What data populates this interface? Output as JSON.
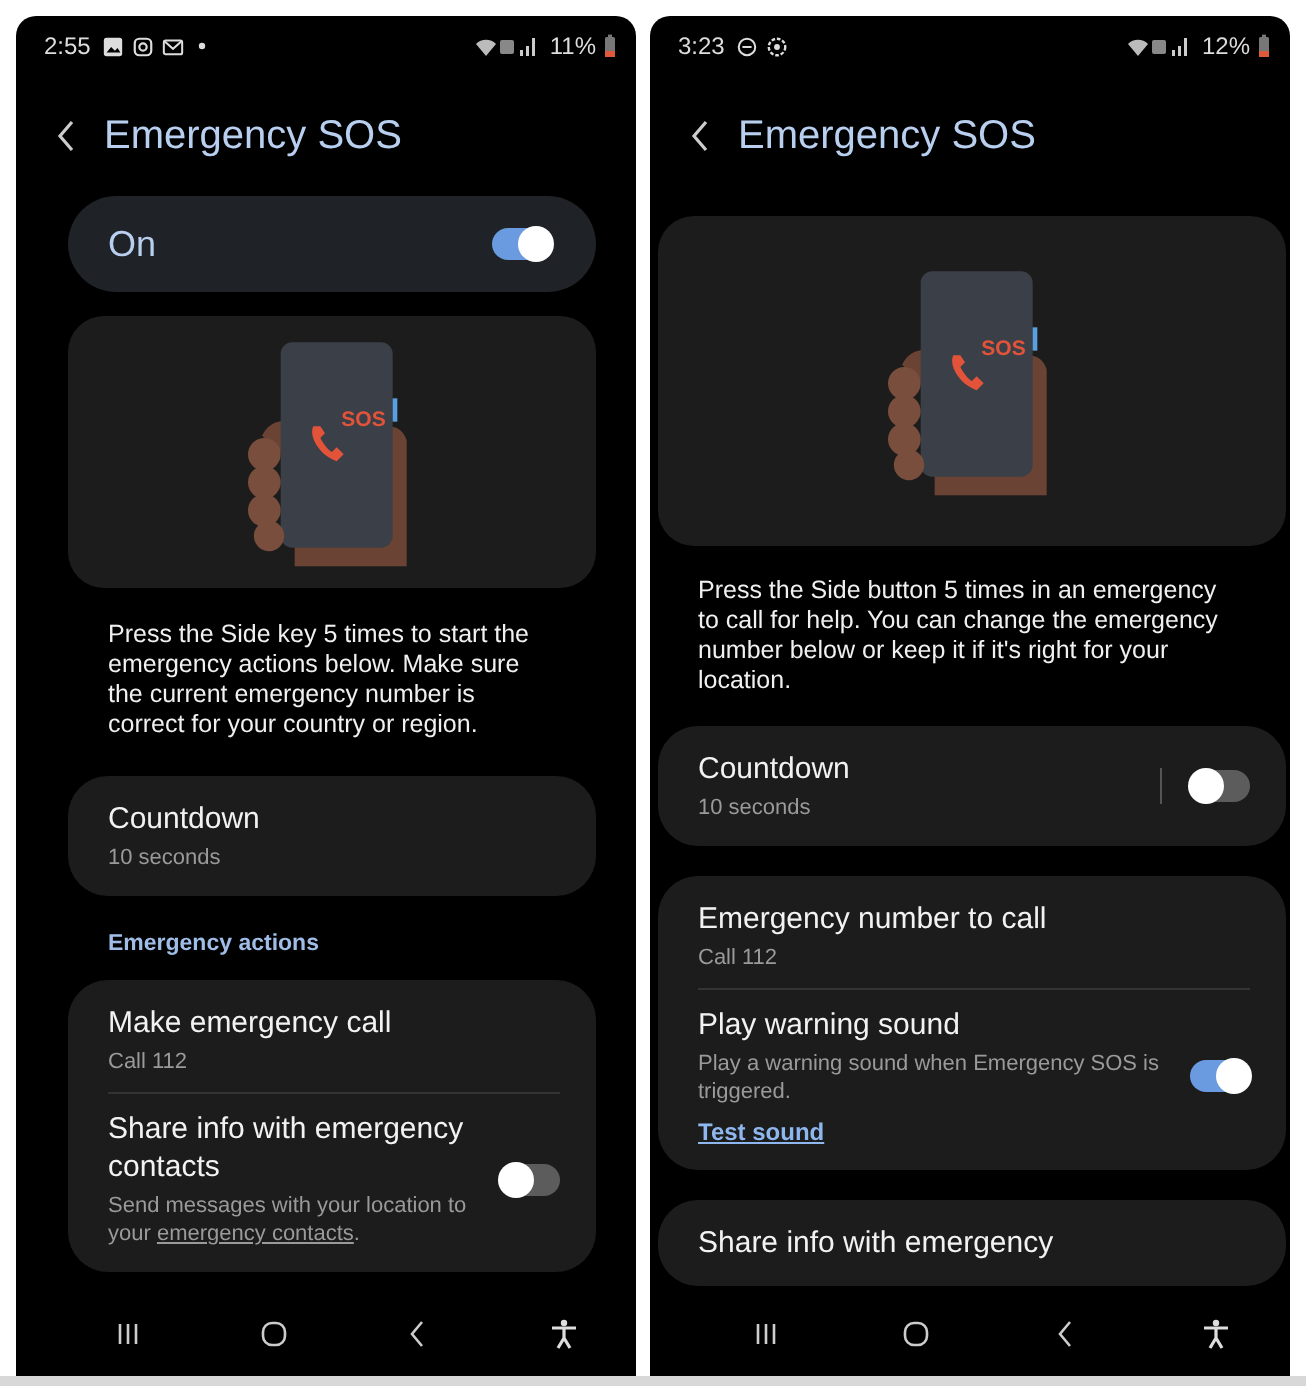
{
  "screens": [
    {
      "status_bar": {
        "time": "2:55",
        "battery": "11%"
      },
      "title": "Emergency SOS",
      "blocks": [
        {
          "kind": "switch_bar",
          "label": "On",
          "on": true
        },
        {
          "kind": "illustration",
          "badge": "SOS"
        },
        {
          "kind": "text",
          "text": "Press the Side key 5 times to start the emergency actions below. Make sure the current emergency number is correct for your country or region."
        },
        {
          "kind": "card",
          "items": [
            {
              "title": "Countdown",
              "subtitle": "10 seconds"
            }
          ]
        },
        {
          "kind": "section",
          "text": "Emergency actions"
        },
        {
          "kind": "card",
          "items": [
            {
              "title": "Make emergency call",
              "subtitle": "Call 112"
            },
            {
              "title": "Share info with emergency contacts",
              "subtitle": "Send messages with your location to your ",
              "subtitle_link": "emergency contacts",
              "subtitle_end": ".",
              "on": false,
              "separated": false
            }
          ]
        }
      ]
    },
    {
      "status_bar": {
        "time": "3:23",
        "battery": "12%"
      },
      "title": "Emergency SOS",
      "blocks": [
        {
          "kind": "illustration",
          "badge": "SOS"
        },
        {
          "kind": "text",
          "text": "Press the Side button 5 times in an emergency to call for help. You can change the emergency number below or keep it if it's right for your location."
        },
        {
          "kind": "card",
          "items": [
            {
              "title": "Countdown",
              "subtitle": "10 seconds",
              "on": false,
              "separated": true
            }
          ]
        },
        {
          "kind": "card",
          "items": [
            {
              "title": "Emergency number to call",
              "subtitle": "Call 112"
            },
            {
              "title": "Play warning sound",
              "subtitle": "Play a warning sound when Emergency SOS is triggered.",
              "link": "Test sound",
              "on": true,
              "separated": false
            }
          ]
        },
        {
          "kind": "card",
          "items": [
            {
              "title": "Share info with emergency"
            }
          ]
        }
      ]
    }
  ]
}
